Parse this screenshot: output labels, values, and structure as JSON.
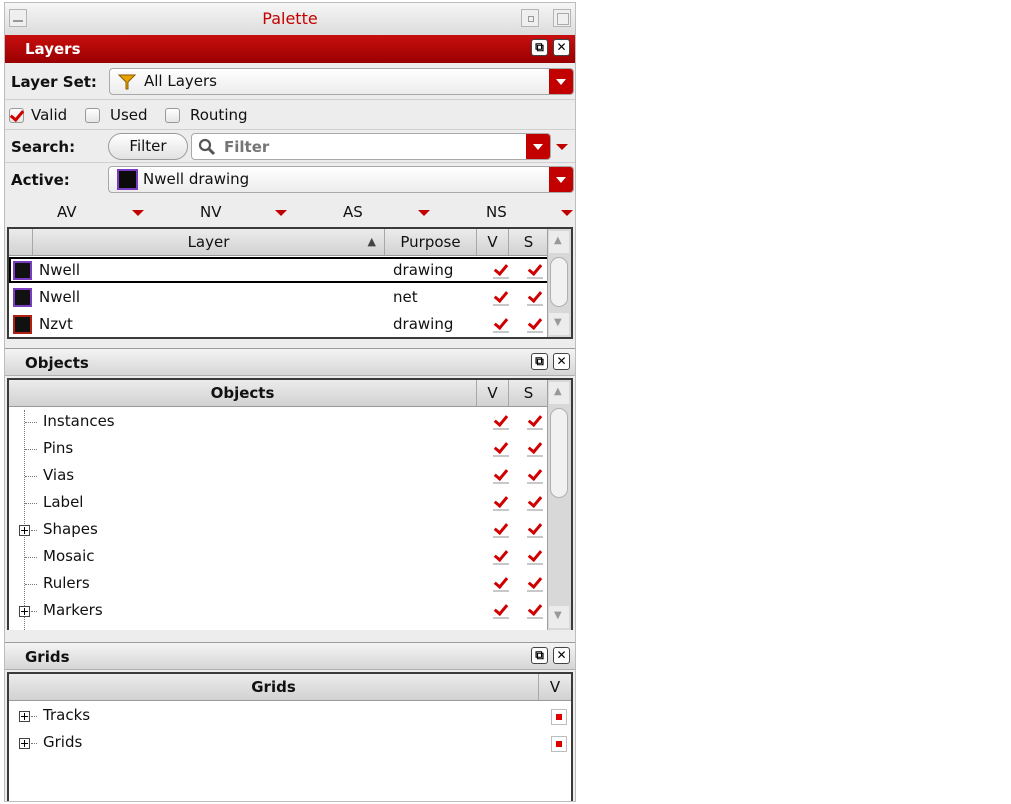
{
  "window": {
    "title": "Palette"
  },
  "layers": {
    "header": "Layers",
    "layer_set_label": "Layer Set:",
    "layer_set_value": "All Layers",
    "valid_label": "Valid",
    "used_label": "Used",
    "routing_label": "Routing",
    "valid_checked": true,
    "used_checked": false,
    "routing_checked": false,
    "search_label": "Search:",
    "filter_button": "Filter",
    "filter_placeholder": "Filter",
    "active_label": "Active:",
    "active_value": "Nwell drawing",
    "toggles": [
      "AV",
      "NV",
      "AS",
      "NS"
    ],
    "columns": {
      "layer": "Layer",
      "purpose": "Purpose",
      "v": "V",
      "s": "S"
    },
    "rows": [
      {
        "layer": "Nwell",
        "purpose": "drawing",
        "v": true,
        "s": true,
        "swatch_border": "#7a3cc0"
      },
      {
        "layer": "Nwell",
        "purpose": "net",
        "v": true,
        "s": true,
        "swatch_border": "#7a3cc0"
      },
      {
        "layer": "Nzvt",
        "purpose": "drawing",
        "v": true,
        "s": true,
        "swatch_border": "#b02010"
      }
    ]
  },
  "objects": {
    "header": "Objects",
    "columns": {
      "name": "Objects",
      "v": "V",
      "s": "S"
    },
    "items": [
      {
        "label": "Instances",
        "expandable": false
      },
      {
        "label": "Pins",
        "expandable": false
      },
      {
        "label": "Vias",
        "expandable": false
      },
      {
        "label": "Label",
        "expandable": false
      },
      {
        "label": "Shapes",
        "expandable": true
      },
      {
        "label": "Mosaic",
        "expandable": false
      },
      {
        "label": "Rulers",
        "expandable": false
      },
      {
        "label": "Markers",
        "expandable": true
      }
    ]
  },
  "grids": {
    "header": "Grids",
    "columns": {
      "name": "Grids",
      "v": "V"
    },
    "items": [
      {
        "label": "Tracks",
        "expandable": true
      },
      {
        "label": "Grids",
        "expandable": true
      }
    ]
  },
  "colors": {
    "accent": "#c30000",
    "check": "#d00000"
  }
}
